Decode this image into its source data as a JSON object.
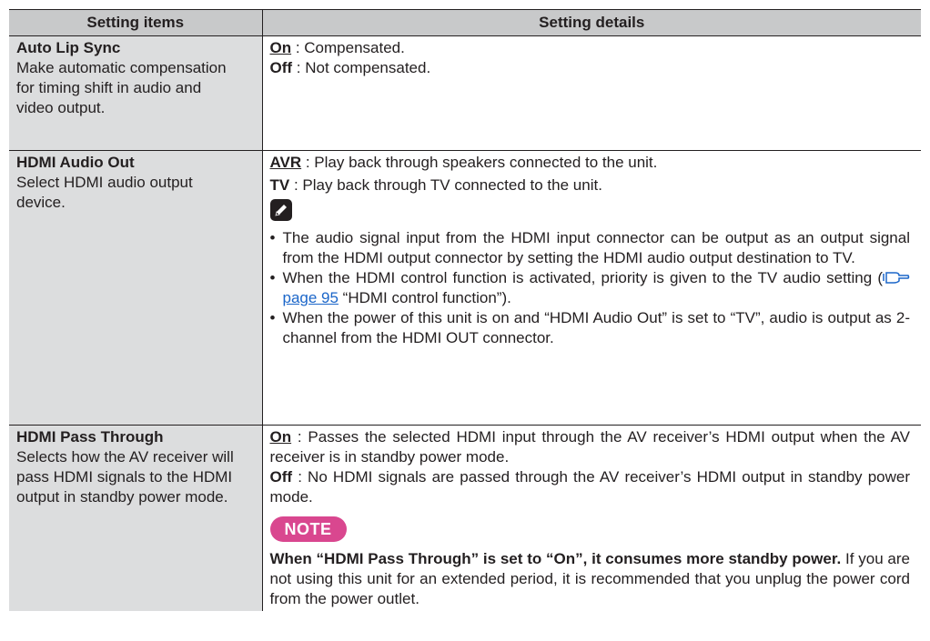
{
  "table": {
    "header": {
      "col1": "Setting items",
      "col2": "Setting details"
    },
    "rows": [
      {
        "title": "Auto Lip Sync",
        "desc": "Make automatic compensation for timing shift in audio and video output.",
        "options": [
          {
            "key": "On",
            "text": " : Compensated."
          },
          {
            "key": "Off",
            "text": " : Not compensated."
          }
        ]
      },
      {
        "title": "HDMI Audio Out",
        "desc": "Select HDMI audio output device.",
        "options": [
          {
            "key": "AVR",
            "text": " : Play back through speakers connected to the unit."
          },
          {
            "key": "TV",
            "text": " : Play back through TV connected to the unit."
          }
        ],
        "note_icon": "pencil-icon",
        "bullets": {
          "b1": "The audio signal input from the HDMI input connector can be output as an output signal from the HDMI output connector by setting the HDMI audio output destination to TV.",
          "b2_pre": "When the HDMI control function is activated, priority is given to the TV audio setting (",
          "b2_link": "page 95",
          "b2_post": " “HDMI control function”).",
          "b3": "When the power of this unit is on and “HDMI Audio Out” is set to “TV”, audio is output as 2-channel from the HDMI OUT connector."
        },
        "bullet_char": "•",
        "ref_icon": "reference-hand-icon"
      },
      {
        "title": "HDMI Pass Through",
        "desc": "Selects how the AV receiver will pass HDMI signals to the HDMI output in standby power mode.",
        "options": [
          {
            "key": "On",
            "text": " : Passes the selected HDMI input through the AV receiver’s HDMI output when the AV receiver is in standby power mode."
          },
          {
            "key": "Off",
            "text": " : No HDMI signals are passed through the AV receiver’s HDMI output in standby power mode."
          }
        ],
        "note_label": "NOTE",
        "note_bold": "When “HDMI Pass Through” is set to “On”, it consumes more standby power.",
        "note_text": " If you are not using this unit for an extended period, it is recommended that you unplug the power cord from the power outlet."
      }
    ]
  },
  "colors": {
    "header_bg": "#c8c9ca",
    "item_bg": "#dcddde",
    "note_badge": "#d9478f",
    "link": "#1b66c9"
  }
}
